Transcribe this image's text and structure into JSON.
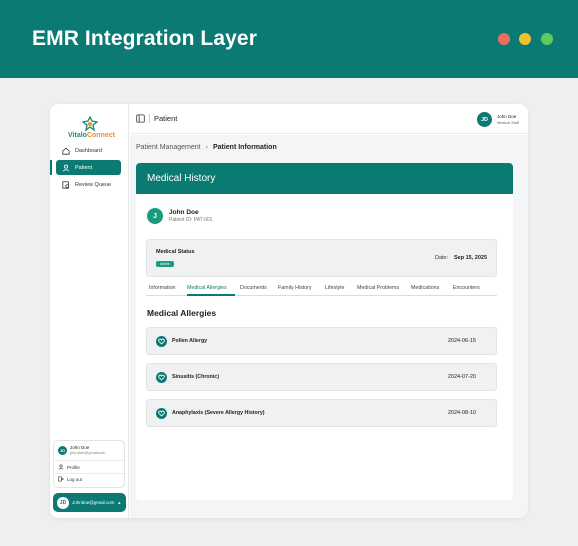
{
  "banner": {
    "title": "EMR Integration Layer"
  },
  "brand": {
    "name_part1": "Vitalo",
    "name_part2": "Connect"
  },
  "sidebar": {
    "items": [
      {
        "label": "Dashboard",
        "icon": "home-icon"
      },
      {
        "label": "Patient",
        "icon": "user-icon",
        "active": true
      },
      {
        "label": "Review Queue",
        "icon": "review-icon"
      }
    ]
  },
  "user": {
    "initials": "JD",
    "name": "John Doe",
    "email": "johndoe@gmailcom",
    "menu": {
      "profile": "Profile",
      "logout": "Log out"
    },
    "account_email": "Johndoe@gmail.com"
  },
  "topbar": {
    "title": "Patient",
    "user_name": "John Doe",
    "user_role": "Medical Staff",
    "user_initials": "JD"
  },
  "breadcrumb": {
    "parent": "Patient Management",
    "current": "Patient Information"
  },
  "card": {
    "title": "Medical History"
  },
  "patient": {
    "initial": "J",
    "name": "John Doe",
    "id_text": "Patient ID: PAT-001"
  },
  "status": {
    "label": "Medical Status",
    "badge": "Active",
    "date_label": "Date:",
    "date": "Sep 15, 2025"
  },
  "tabs": [
    {
      "label": "Information"
    },
    {
      "label": "Medical Allergies",
      "active": true
    },
    {
      "label": "Documents"
    },
    {
      "label": "Family History"
    },
    {
      "label": "Lifestyle"
    },
    {
      "label": "Medical Problems"
    },
    {
      "label": "Medications"
    },
    {
      "label": "Encounters"
    }
  ],
  "section": {
    "title": "Medical Allergies"
  },
  "allergies": [
    {
      "name": "Pollen Allergy",
      "date": "2024-06-15"
    },
    {
      "name": "Sinusitis (Chronic)",
      "date": "2024-07-20"
    },
    {
      "name": "Anaphylaxis (Severe Allergy History)",
      "date": "2024-08-10"
    }
  ],
  "colors": {
    "primary": "#0b7a72",
    "accent_green": "#1b9a7f",
    "logo_orange": "#f28a2e"
  }
}
